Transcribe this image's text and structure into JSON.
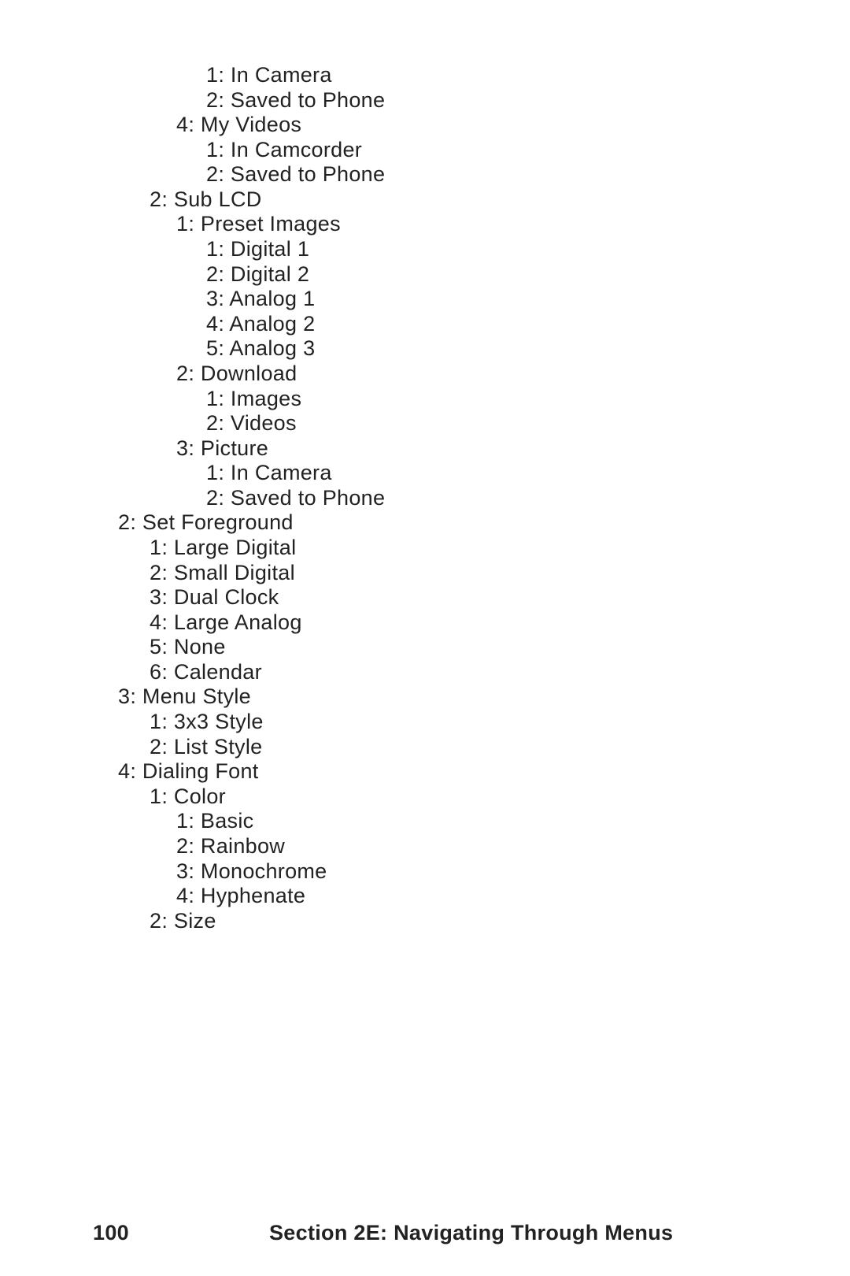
{
  "lines": [
    {
      "level": 4,
      "text": "1: In Camera"
    },
    {
      "level": 4,
      "text": "2: Saved to Phone"
    },
    {
      "level": 3,
      "text": "4: My Videos"
    },
    {
      "level": 4,
      "text": "1: In Camcorder"
    },
    {
      "level": 4,
      "text": "2: Saved to Phone"
    },
    {
      "level": 2,
      "text": "2: Sub LCD"
    },
    {
      "level": 3,
      "text": "1: Preset Images"
    },
    {
      "level": 4,
      "text": "1: Digital 1"
    },
    {
      "level": 4,
      "text": "2: Digital 2"
    },
    {
      "level": 4,
      "text": "3: Analog 1"
    },
    {
      "level": 4,
      "text": "4: Analog 2"
    },
    {
      "level": 4,
      "text": "5: Analog 3"
    },
    {
      "level": 3,
      "text": "2: Download"
    },
    {
      "level": 4,
      "text": "1: Images"
    },
    {
      "level": 4,
      "text": "2: Videos"
    },
    {
      "level": 3,
      "text": "3: Picture"
    },
    {
      "level": 4,
      "text": "1: In Camera"
    },
    {
      "level": 4,
      "text": "2: Saved to Phone"
    },
    {
      "level": 1,
      "text": "2: Set Foreground"
    },
    {
      "level": 2,
      "text": "1: Large Digital"
    },
    {
      "level": 2,
      "text": "2: Small Digital"
    },
    {
      "level": 2,
      "text": "3: Dual Clock"
    },
    {
      "level": 2,
      "text": "4: Large Analog"
    },
    {
      "level": 2,
      "text": "5: None"
    },
    {
      "level": 2,
      "text": "6: Calendar"
    },
    {
      "level": 1,
      "text": "3: Menu Style"
    },
    {
      "level": 2,
      "text": "1: 3x3 Style"
    },
    {
      "level": 2,
      "text": "2: List Style"
    },
    {
      "level": 1,
      "text": "4: Dialing Font"
    },
    {
      "level": 2,
      "text": "1: Color"
    },
    {
      "level": 3,
      "text": "1: Basic"
    },
    {
      "level": 3,
      "text": "2: Rainbow"
    },
    {
      "level": 3,
      "text": "3: Monochrome"
    },
    {
      "level": 3,
      "text": "4: Hyphenate"
    },
    {
      "level": 2,
      "text": "2: Size"
    }
  ],
  "footer": {
    "page": "100",
    "section": "Section 2E: Navigating Through Menus"
  }
}
